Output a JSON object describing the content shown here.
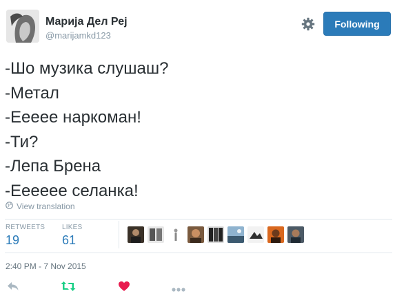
{
  "header": {
    "display_name": "Марија Дел Реј",
    "handle": "@marijamkd123",
    "follow_label": "Following"
  },
  "tweet": {
    "lines": [
      "-Шо музика слушаш?",
      "-Метал",
      "-Ееeee наркоман!",
      "-Ти?",
      "-Лепа Брена",
      "-Ееeeee селанка!"
    ],
    "translate_label": "View translation"
  },
  "stats": {
    "retweets_label": "RETWEETS",
    "retweets_count": "19",
    "likes_label": "LIKES",
    "likes_count": "61",
    "liker_count": 9
  },
  "meta": {
    "timestamp": "2:40 PM - 7 Nov 2015"
  },
  "icons": {
    "settings": "gear-icon",
    "translate": "globe-icon",
    "reply": "reply-icon",
    "retweet": "retweet-icon",
    "like": "heart-icon",
    "more": "more-icon"
  },
  "colors": {
    "accent": "#2b7bb9",
    "retweet": "#19cf86",
    "like": "#e81c4f",
    "muted": "#8899a6",
    "text": "#292f33"
  }
}
